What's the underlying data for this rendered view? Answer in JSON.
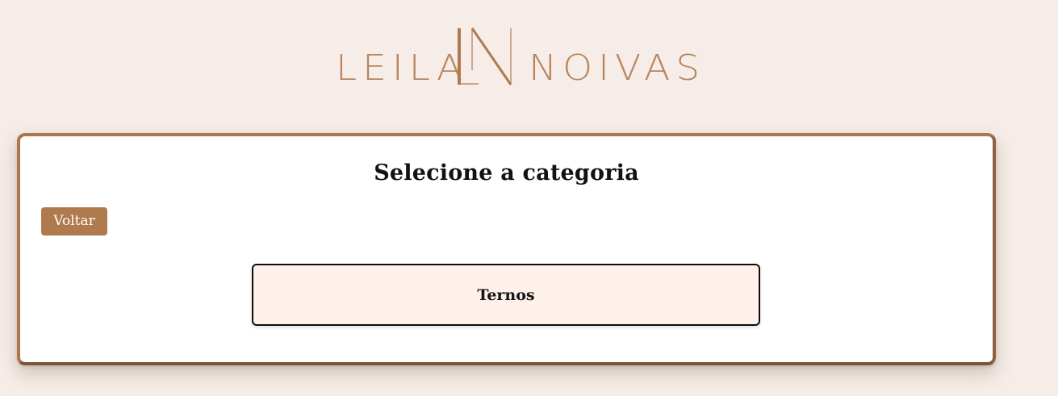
{
  "brand": {
    "logo_left_word": "LEILA",
    "logo_monogram": "LN",
    "logo_right_word": "NOIVAS",
    "accent_color": "#b07a4f"
  },
  "panel": {
    "title": "Selecione a categoria",
    "back_button_label": "Voltar",
    "categories": [
      {
        "label": "Ternos"
      }
    ]
  },
  "colors": {
    "background": "#f6ede8",
    "panel_border": "#ad7650",
    "category_background": "#fdf1ea"
  }
}
